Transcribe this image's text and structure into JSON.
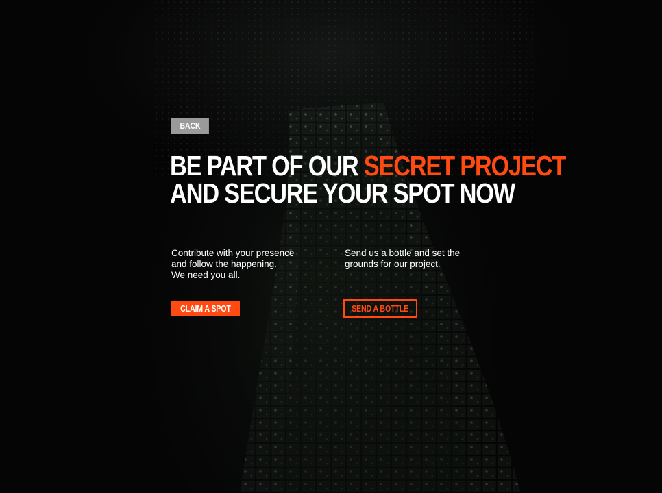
{
  "nav": {
    "back_label": "BACK"
  },
  "headline": {
    "line1_prefix": "BE PART OF OUR ",
    "line1_accent": "SECRET PROJECT",
    "line2": "AND SECURE YOUR SPOT NOW"
  },
  "options": {
    "presence": {
      "line1": "Contribute with your presence",
      "line2": "and follow the happening.",
      "line3": "We need you all.",
      "button_label": "CLAIM A SPOT"
    },
    "bottle": {
      "line1": "Send us a bottle and set the",
      "line2": "grounds for our project.",
      "button_label": "SEND A BOTTLE"
    }
  },
  "colors": {
    "accent": "#ff4a12",
    "background": "#050505",
    "back_button": "#9a9a9a",
    "text": "#ffffff"
  }
}
